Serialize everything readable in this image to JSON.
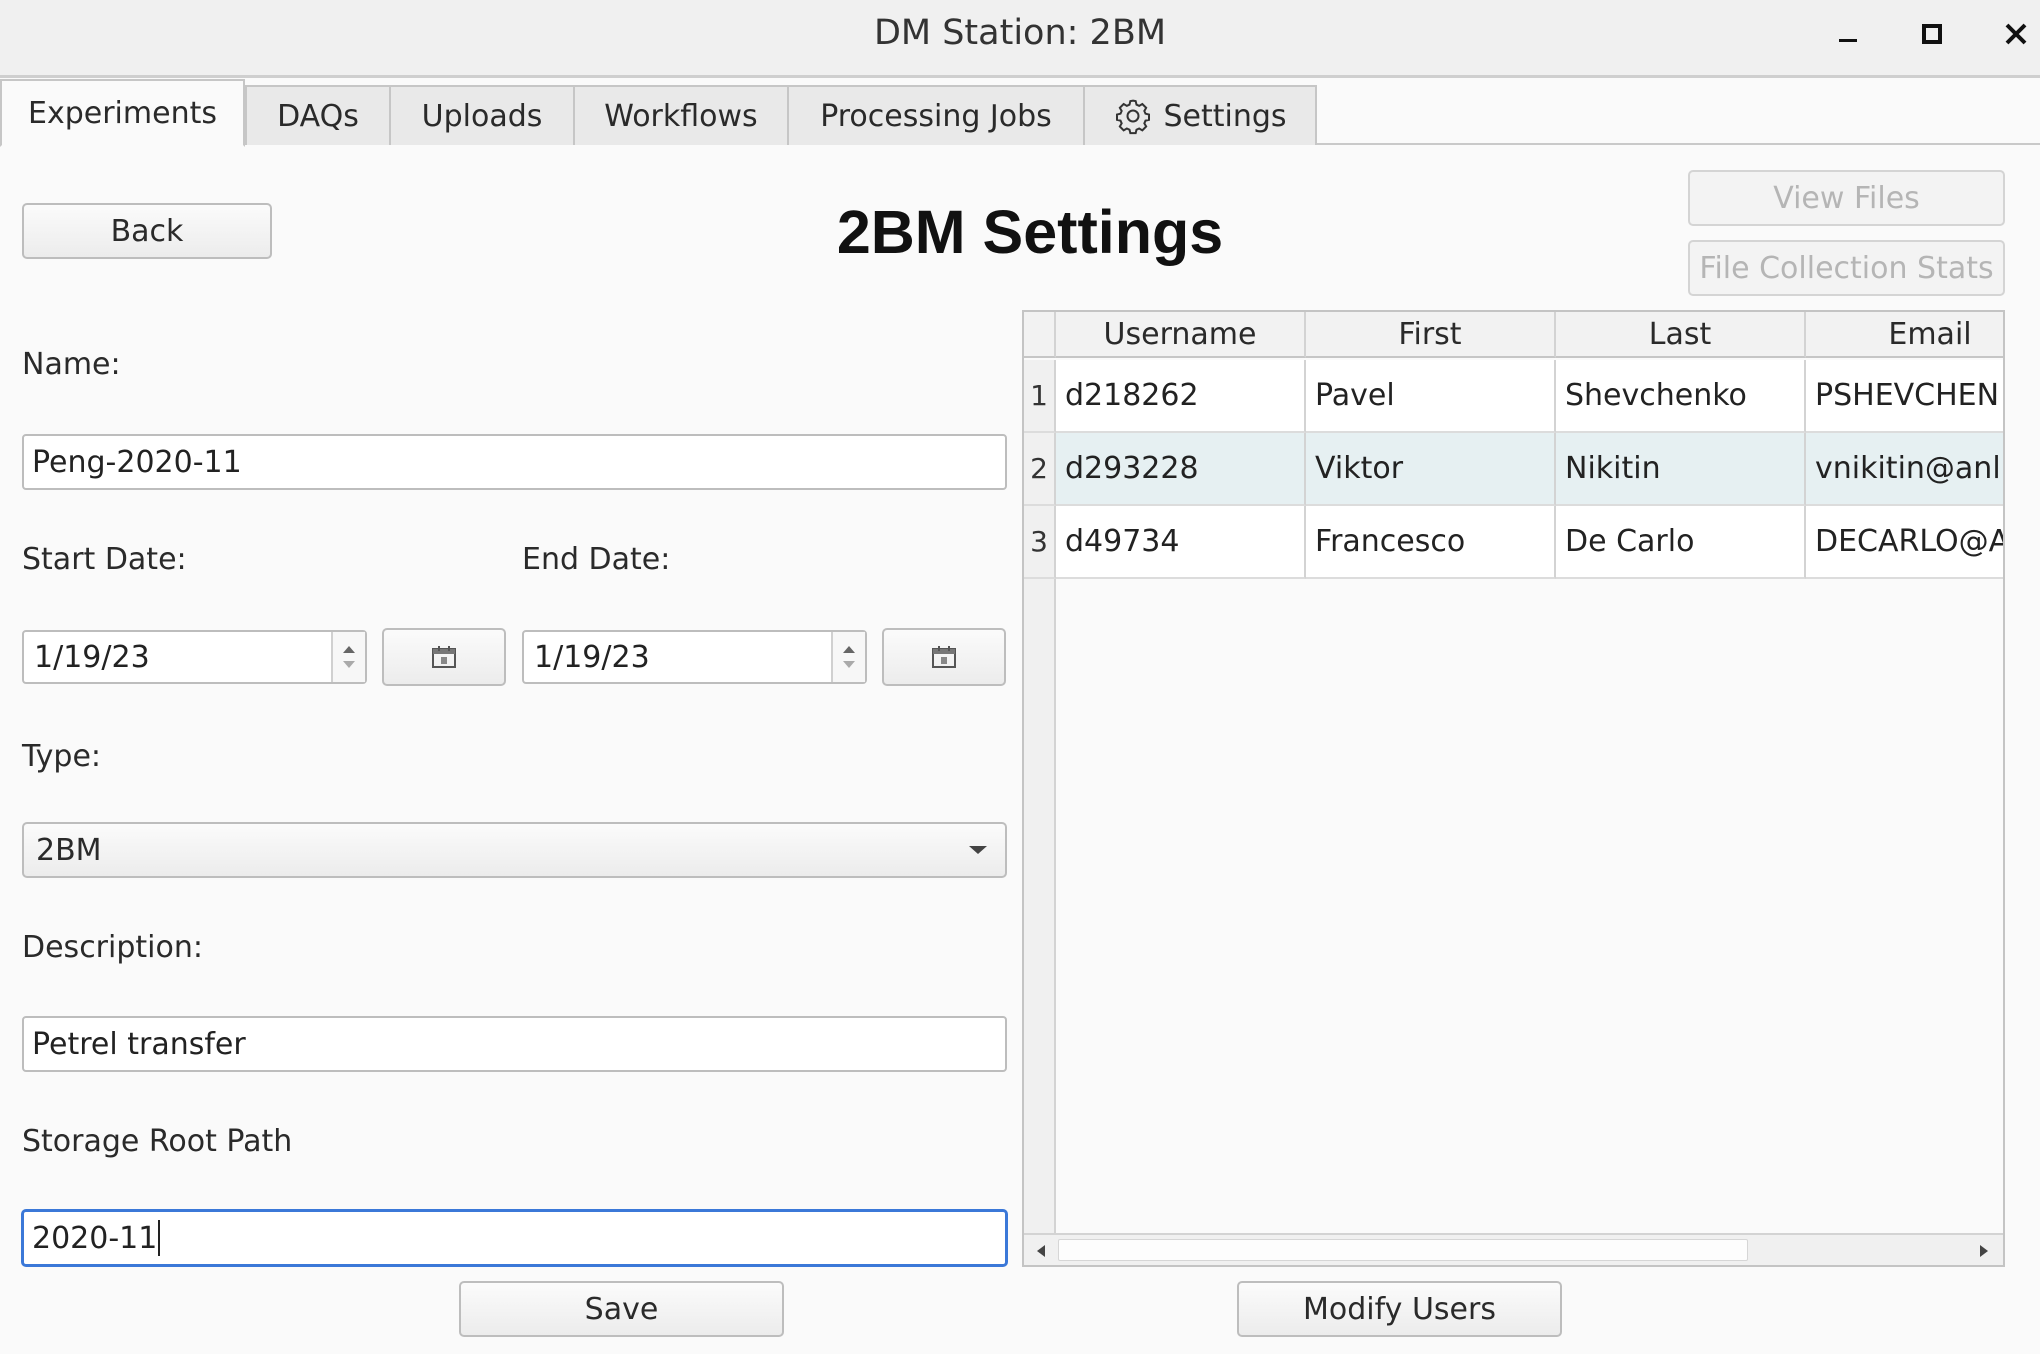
{
  "window": {
    "title": "DM Station: 2BM"
  },
  "tabs": [
    {
      "label": "Experiments",
      "active": true
    },
    {
      "label": "DAQs"
    },
    {
      "label": "Uploads"
    },
    {
      "label": "Workflows"
    },
    {
      "label": "Processing Jobs"
    },
    {
      "label": "Settings",
      "icon": "gear-icon"
    }
  ],
  "toolbar": {
    "back_label": "Back",
    "view_files_label": "View Files",
    "file_stats_label": "File Collection Stats"
  },
  "page": {
    "heading": "2BM Settings"
  },
  "form": {
    "name_label": "Name:",
    "name_value": "Peng-2020-11",
    "start_label": "Start Date:",
    "start_value": "1/19/23",
    "end_label": "End Date:",
    "end_value": "1/19/23",
    "type_label": "Type:",
    "type_value": "2BM",
    "description_label": "Description:",
    "description_value": "Petrel transfer",
    "storage_label": "Storage Root Path",
    "storage_value": "2020-11",
    "save_label": "Save"
  },
  "users_table": {
    "columns": [
      "Username",
      "First",
      "Last",
      "Email"
    ],
    "rows": [
      {
        "num": "1",
        "username": "d218262",
        "first": "Pavel",
        "last": "Shevchenko",
        "email": "PSHEVCHEN"
      },
      {
        "num": "2",
        "username": "d293228",
        "first": "Viktor",
        "last": "Nikitin",
        "email": "vnikitin@anl",
        "selected": true
      },
      {
        "num": "3",
        "username": "d49734",
        "first": "Francesco",
        "last": "De Carlo",
        "email": "DECARLO@A"
      }
    ],
    "modify_label": "Modify Users"
  },
  "colors": {
    "accent": "#3b78d8",
    "selected_row": "#e6f0f2",
    "disabled_text": "#b5b5b5"
  }
}
